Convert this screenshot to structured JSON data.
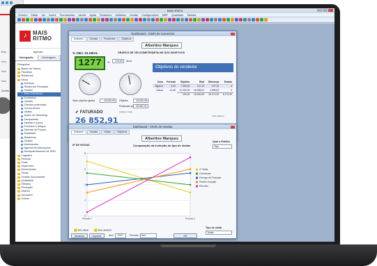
{
  "background_app": {
    "lines": [
      "Enc",
      "Nos",
      "Nos",
      "Nos",
      "Aceite"
    ]
  },
  "window": {
    "title": "Mais Ritmo"
  },
  "menu": [
    "Ficheiro",
    "Editar",
    "Ver",
    "Inserir",
    "Ferramentas",
    "Janela",
    "Ajuda",
    "Relatórios",
    "Utilitários",
    "Gestão",
    "Configurações",
    "MRP",
    "Qualidade",
    "Tabelas"
  ],
  "nav": {
    "logo_line1": "MAIS",
    "logo_line2": "RITMO",
    "header": "Agenda",
    "tab_navigation": "Navegação",
    "tab_messages": "Mensagens",
    "section": "Pesquisar",
    "items": [
      {
        "label": "Bases de Dados",
        "icon": "folder-icon",
        "selected": false
      },
      {
        "label": "Favoritos",
        "icon": "folder-icon",
        "selected": false
      },
      {
        "label": "Relatórios",
        "icon": "folder-icon",
        "selected": false
      },
      {
        "label": "Menu",
        "icon": "folder-icon",
        "selected": false
      },
      {
        "label": "Acessos",
        "icon": "item-icon",
        "selected": false
      },
      {
        "label": "Relatórios Principais",
        "icon": "item-icon",
        "selected": false
      },
      {
        "label": "Gestão",
        "icon": "item-icon",
        "selected": false
      },
      {
        "label": "Área Comercial",
        "icon": "item-icon",
        "selected": true
      },
      {
        "label": "Contactos",
        "icon": "item-icon",
        "selected": false
      },
      {
        "label": "Vendas",
        "icon": "item-icon",
        "selected": false
      },
      {
        "label": "Clientes potenciais",
        "icon": "item-icon",
        "selected": false
      },
      {
        "label": "Concorrência",
        "icon": "item-icon",
        "selected": false
      },
      {
        "label": "Visitas",
        "icon": "item-icon",
        "selected": false
      },
      {
        "label": "Ações de Marketing",
        "icon": "item-icon",
        "selected": false
      },
      {
        "label": "Campanhas",
        "icon": "item-icon",
        "selected": false
      },
      {
        "label": "Tarefas e Ações",
        "icon": "item-icon",
        "selected": false
      },
      {
        "label": "Produtos e Artigos",
        "icon": "item-icon",
        "selected": false
      },
      {
        "label": "Tabelas de Preços",
        "icon": "item-icon",
        "selected": false
      },
      {
        "label": "Entidades",
        "icon": "item-icon",
        "selected": false
      },
      {
        "label": "Relatórios",
        "icon": "item-icon",
        "selected": false
      },
      {
        "label": "Gestão",
        "icon": "item-icon",
        "selected": false
      },
      {
        "label": "Movimentos",
        "icon": "item-icon",
        "selected": false
      },
      {
        "label": "Agenda de Marcações",
        "icon": "item-icon",
        "selected": false
      },
      {
        "label": "Acompanhamento de SMS",
        "icon": "item-icon",
        "selected": false
      },
      {
        "label": "Logística",
        "icon": "folder-icon",
        "selected": false
      },
      {
        "label": "Pessoal",
        "icon": "folder-icon",
        "selected": false
      },
      {
        "label": "Frota",
        "icon": "folder-icon",
        "selected": false
      },
      {
        "label": "Supervisor",
        "icon": "folder-icon",
        "selected": false
      },
      {
        "label": "Documentos",
        "icon": "folder-icon",
        "selected": false
      },
      {
        "label": "Obras",
        "icon": "folder-icon",
        "selected": false
      },
      {
        "label": "Gestão Documental",
        "icon": "folder-icon",
        "selected": false
      },
      {
        "label": "Qualidade",
        "icon": "folder-icon",
        "selected": false
      },
      {
        "label": "Oficinas",
        "icon": "folder-icon",
        "selected": false
      },
      {
        "label": "Produção",
        "icon": "folder-icon",
        "selected": false
      },
      {
        "label": "Arquivo",
        "icon": "folder-icon",
        "selected": false
      },
      {
        "label": "Armazém",
        "icon": "folder-icon",
        "selected": false
      },
      {
        "label": "Outros",
        "icon": "folder-icon",
        "selected": false
      }
    ]
  },
  "panel1": {
    "title": "Dashboard - Chefe de Comercial",
    "tabs": [
      "Indicares",
      "Vendas",
      "Pendentes",
      "Objetivos"
    ],
    "person": "Albertino Marques",
    "counter_title": "% OBJ. GLOBAL",
    "counter_value": "1277",
    "percent_sign": "%",
    "year_value": "122,09",
    "year_label": "Anos",
    "col_title1": "GRÁFICO DE VELOCÍMETRO",
    "col_title2": "DETALHE DOS OBJETIVOS",
    "objetivo_label": "Valor objetivo global",
    "objetivo_value": "18.000,00",
    "real_label": "Objetivo",
    "real_value": "18.000,00",
    "realizado_label": "Realizado global",
    "realizado_value": "26.852,91",
    "note": "(valores reais)",
    "fat_label": "FATURADO",
    "fat_value": "26 852,91",
    "banner": "Objetivos do vendedor",
    "table_headers": [
      "Zona",
      "Período",
      "Objetivo",
      "Real",
      "Diferença",
      "Estado"
    ],
    "table_rows": [
      [
        "Algarve",
        "0,00",
        "7.500,00",
        "137,19",
        "137,19",
        "♥"
      ],
      [
        "Lisboa",
        "41,69",
        "11.000,00",
        "18.085,81",
        "4.585,81",
        "♥"
      ]
    ],
    "table_total": [
      "",
      "",
      "100,00",
      "18.000,00",
      "26.172,00",
      "8.172,00"
    ],
    "table_footnote": "Total objetivo",
    "btn_atualizar": "Atualizar",
    "btn_imprimir": "Imprimir",
    "ano_label": "Ano:",
    "ano_value": "2017",
    "periodo_label": "Período:",
    "periodo_value": "Ano",
    "ok": "OK"
  },
  "panel2": {
    "title": "Dashboard - Chefe de Vendas",
    "tabs": [
      "Indicares",
      "Vendas",
      "Visitas",
      "Objetivos"
    ],
    "person": "Albertino Marques",
    "left_header": "Nº DE VISITAS",
    "chart_title": "Comparação da evolução do tipo de visitas",
    "right_label": "Qual o Gráfico",
    "right_value": "Tipo",
    "legend_bottom": [
      {
        "label": "Ano atual",
        "color": "#e8c80a"
      },
      {
        "label": "Ano anterior",
        "color": "#e8c80a"
      }
    ],
    "tipo_visita_label": "Tipo de visita",
    "tipo_visita_value": "Todas",
    "btn_atualizar": "Atualizar",
    "btn_imprimir": "Imprimir",
    "ano_label": "Ano:",
    "ano_value": "2017",
    "periodo_label": "Período:",
    "periodo_value": "Ano",
    "ok": "OK"
  },
  "chart_data": {
    "type": "line",
    "title": "Comparação da evolução do tipo de visitas",
    "x": [
      "Período 1",
      "Período 2"
    ],
    "xlabel": "",
    "ylabel": "",
    "series": [
      {
        "name": "1ª Visita",
        "color": "#e8c80a",
        "values": [
          7,
          3
        ]
      },
      {
        "name": "Cobranças",
        "color": "#2ca02c",
        "values": [
          5.5,
          4
        ]
      },
      {
        "name": "Entrega de Proposta",
        "color": "#1f5fbf",
        "values": [
          4,
          5.5
        ]
      },
      {
        "name": "Pedido Orçação",
        "color": "#ff8c00",
        "values": [
          3,
          6
        ]
      },
      {
        "name": "Reunião",
        "color": "#d02cd0",
        "values": [
          0.5,
          7.5
        ]
      }
    ],
    "ylim": [
      0,
      8
    ],
    "grid": true,
    "legend": "right"
  }
}
